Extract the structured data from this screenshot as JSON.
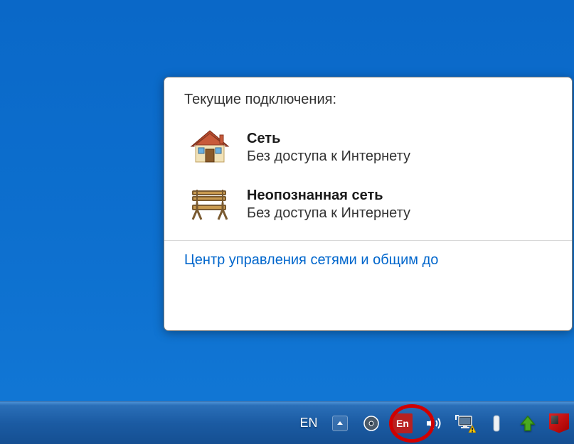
{
  "flyout": {
    "title": "Текущие подключения:",
    "connections": [
      {
        "name": "Сеть",
        "status": "Без доступа к Интернету",
        "icon": "house"
      },
      {
        "name": "Неопознанная сеть",
        "status": "Без доступа к Интернету",
        "icon": "bench"
      }
    ],
    "link": "Центр управления сетями и общим до"
  },
  "tray": {
    "language": "EN",
    "punto": "En"
  }
}
